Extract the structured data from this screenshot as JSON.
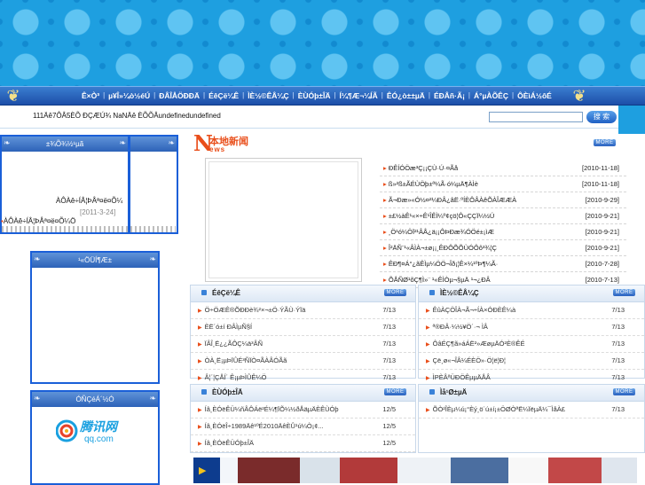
{
  "nav": {
    "items": [
      "Ê×Ò³",
      "µ¥Î»¼ò½éÚ",
      "ÐÂÎÅÖÐÐÄ",
      "ÉêÇë¼Ê",
      "ÌÈ½©ÊÂ¼Ç",
      "ÈÙÓþ±ÎÄ",
      "Í¼¶Æ¬¼ÍÃ",
      "ÊÓ¿ò±±µÄ",
      "ÉÐÂñ·Ã¡",
      "Á°µÀÕÊÇ",
      "ÔÈìÁ½ôÉ"
    ]
  },
  "ticker": {
    "text": "111Äê7ÔÂ5ÈÕ ÐÇÆÚ¾ NaNÄê ÈÕÕÂundefinedundefined"
  },
  "search": {
    "placeholder": "",
    "button_label": "搜 索"
  },
  "left": {
    "pic_box_title_left": "±¾Õ¾½¹µã",
    "pic_caption": "ÀÔÀê÷ÍÂ¦ÞÅª¤ë¤Õ¼",
    "pic_date": "[2011-3-24]",
    "mini_caption": "ÀÔÀê÷ÍÂ¦ÞÅª¤ë¤Õ¼Ö",
    "notice_title": "¹«ÖÜÍ¶Æ±",
    "links_title": "ÓÑÇéÁ´½Ó",
    "link_logo_text": "腾讯网",
    "link_logo_sub": "qq.com"
  },
  "news": {
    "logo_cn": "本地新闻",
    "logo_en": "ews",
    "more_label": "MORE",
    "items": [
      {
        "title": "ÐÊÍÓÖæ³Ç¡¡ÇÙ·Ú·¤Ãå",
        "date": "[2010-11-18]"
      },
      {
        "title": "ß»²ß±ÃÉÙÖþ±ª¼Ã·ó¼µÄ¶ÀÌè",
        "date": "[2010-11-18]"
      },
      {
        "title": "Ã¬Ðæ»«Ó½¤²¼ÐÂ¿âË·ºÍÈÔÂÀêÕÀÎÆÆÀ",
        "date": "[2010-9-29]"
      },
      {
        "title": "±£½àÊ¹«×÷Ê¹ÎÊÌ¼º¢çö¦Ô«ÇÇÏ¼½Ú",
        "date": "[2010-9-21]"
      },
      {
        "title": "¸Ö¹ó¼ÖÏ²¹ÂÅ¿ä¡¡ÔÞÐæ¾ÓÖé±¡ìÆ",
        "date": "[2010-9-21]"
      },
      {
        "title": "Î²ÄÑ¨¹«ÂÌÀ¬±ø¡¡¸ÊÐÔÕÕÙÓÔô³¾¦Ç",
        "date": "[2010-9-21]"
      },
      {
        "title": "ÊÐ¶¤Á°¿ãÊÌµ¼ÖÖ¬Îð¡¦Ê×¼¹ºÞ¶¼Ã·",
        "date": "[2010-7-28]"
      },
      {
        "title": "ÕÅÑØ¹õÇ¶Ì»¨ ¹«ÊÌÒµ¬§µÄ ¹¬¿ÐÂ",
        "date": "[2010-7-13]"
      }
    ]
  },
  "panels": [
    {
      "title": "ÉêÇë¼Ê",
      "items": [
        {
          "title": "Ö÷ÖÆÊ®ÕÐÐè¾²×¬±Ö·ÝÃÙ·ÝÏä",
          "date": "7/13"
        },
        {
          "title": "ÈË´ó±í ÐÂÌµÑ§Í",
          "date": "7/13"
        },
        {
          "title": "ÏÂÎ¸Ë¿¿ÃÔÇ¼ä³ÂÑ",
          "date": "7/13"
        },
        {
          "title": "ÒÀ¸Ë¡µÞÏÛÉ³ÑÏÒ¤ÃÀÂÓÃã",
          "date": "7/13"
        },
        {
          "title": "Â¦´¦ÇÅÍ´ Ê¡µÞÌÛÊ¼Ö",
          "date": "7/13"
        }
      ]
    },
    {
      "title": "ÌÈ½©ÊÂ¼Ç",
      "items": [
        {
          "title": "ÊûÀÇÖÎÀ¬Ã¬÷ÍÀ×ÓÐÈÊ¼à",
          "date": "7/13"
        },
        {
          "title": "ª®ÐÂ·¼½¥Ö´·¬ ÌÂ",
          "date": "7/13"
        },
        {
          "title": "ÔâÉÇ¶ã»áÁË²»ÆøµÄÓ²È®ÊÉ",
          "date": "7/13"
        },
        {
          "title": "Çë¸ø«¬ÎÂ¼ÉÈÖ»·Ö¦ë¦Ð¦",
          "date": "7/13"
        },
        {
          "title": "ÌPÈÂªÜÐÖÊµµÄÅÂ",
          "date": "7/13"
        }
      ]
    },
    {
      "title": "ÈÙÓþ±ÎÄ",
      "items": [
        {
          "title": "Íâ¸ÈÓëÊÜ¼ñÂÔÁë²É¼¶ÏÕ¼½ðÅäµÄÈÊÙÓþ",
          "date": "12/5"
        },
        {
          "title": "Íâ¸ÈÓëÎ÷1989Äê¹ºÉ2010ÄêÈÛ¹ú¼Ò¡¢...",
          "date": "12/5"
        },
        {
          "title": "Íâ¸ÈÓëÊÜÓþ±ÎÄ",
          "date": "12/5"
        }
      ]
    },
    {
      "title": "Ìå¹Ø±µÄ",
      "items": [
        {
          "title": "ÕÒ²ÎÈµ¼ú¡°Èý¸ö´ú±í¡±ÖØÒªË¼ÏëµÄ¼¯ÌåÀ£",
          "date": "7/13"
        }
      ]
    }
  ]
}
